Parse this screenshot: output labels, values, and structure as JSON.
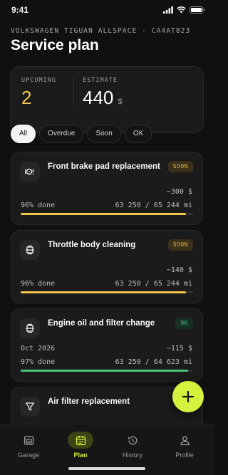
{
  "status_bar": {
    "time": "9:41",
    "icons": [
      "signal-icon",
      "wifi-icon",
      "battery-icon"
    ]
  },
  "header": {
    "vehicle": "VOLKSWAGEN TIGUAN ALLSPACE · CA4AT823",
    "title": "Service plan"
  },
  "summary": {
    "upcoming_label": "UPCOMING",
    "upcoming_value": "2",
    "estimate_label": "ESTIMATE",
    "estimate_value": "440",
    "estimate_currency": "$"
  },
  "filters": [
    {
      "label": "All",
      "active": true
    },
    {
      "label": "Overdue",
      "active": false
    },
    {
      "label": "Soon",
      "active": false
    },
    {
      "label": "OK",
      "active": false
    }
  ],
  "services": [
    {
      "title": "Front brake pad replacement",
      "badge": "SOON",
      "status": "soon",
      "icon": "brake-icon",
      "cost": "~300 $",
      "date": "",
      "done_label": "96% done",
      "progress": 0.96,
      "mileage": "63 250 / 65 244 mi"
    },
    {
      "title": "Throttle body cleaning",
      "badge": "SOON",
      "status": "soon",
      "icon": "engine-icon",
      "cost": "~140 $",
      "date": "",
      "done_label": "96% done",
      "progress": 0.96,
      "mileage": "63 250 / 65 244 mi"
    },
    {
      "title": "Engine oil and filter change",
      "badge": "OK",
      "status": "ok",
      "icon": "engine-icon",
      "cost": "~115 $",
      "date": "Oct 2026",
      "done_label": "97% done",
      "progress": 0.97,
      "mileage": "63 250 / 64 623 mi"
    },
    {
      "title": "Air filter replacement",
      "icon": "filter-icon"
    }
  ],
  "fab": {
    "icon": "plus-icon"
  },
  "tabs": [
    {
      "label": "Garage",
      "icon": "garage-icon",
      "active": false
    },
    {
      "label": "Plan",
      "icon": "calendar-icon",
      "active": true
    },
    {
      "label": "History",
      "icon": "history-icon",
      "active": false
    },
    {
      "label": "Profile",
      "icon": "profile-icon",
      "active": false
    }
  ],
  "colors": {
    "accent": "#d6f03e",
    "soon": "#f1c54a",
    "ok": "#45c47a",
    "background": "#101010",
    "card": "#1b1b1b"
  }
}
